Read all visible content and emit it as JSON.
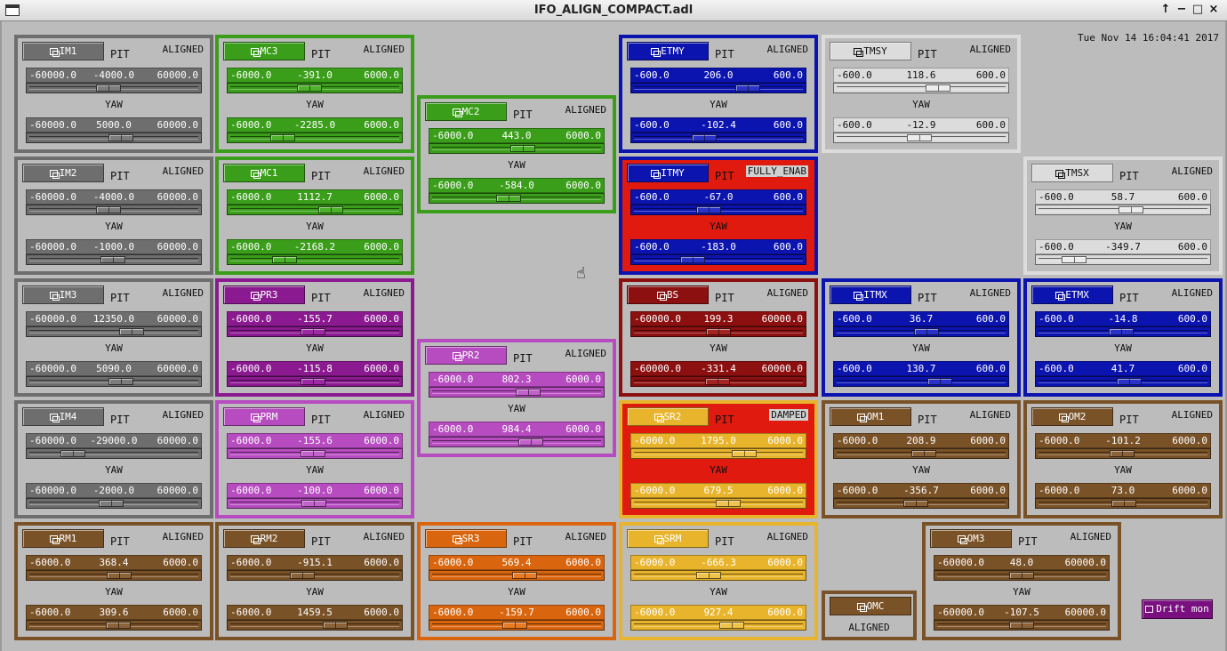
{
  "window": {
    "title": "IFO_ALIGN_COMPACT.adl"
  },
  "clock": "Tue Nov 14 16:04:41 2017",
  "drift_button": "Drift mon",
  "omc": {
    "label": "OMC",
    "status": "ALIGNED"
  },
  "colors": {
    "gray": "#6e6e6e",
    "green": "#3a9e1a",
    "purple": "#8b1a91",
    "violet": "#b64cc0",
    "blue": "#0c14b0",
    "brown": "#7a5228",
    "orange": "#d9660f",
    "yellow": "#e8b42c",
    "red": "#e01a0e",
    "darkred": "#8c1010",
    "white": "#dcdcdc"
  },
  "panels": [
    {
      "label": "IM1",
      "status": "ALIGNED",
      "theme": "gray",
      "pit": {
        "min": "-60000.0",
        "val": "-4000.0",
        "max": "60000.0",
        "frac": 0.467
      },
      "yaw": {
        "min": "-60000.0",
        "val": "5000.0",
        "max": "60000.0",
        "frac": 0.542
      }
    },
    {
      "label": "MC3",
      "status": "ALIGNED",
      "theme": "green",
      "pit": {
        "min": "-6000.0",
        "val": "-391.0",
        "max": "6000.0",
        "frac": 0.467
      },
      "yaw": {
        "min": "-6000.0",
        "val": "-2285.0",
        "max": "6000.0",
        "frac": 0.31
      }
    },
    {
      "label": "MC2",
      "status": "ALIGNED",
      "theme": "green",
      "pit": {
        "min": "-6000.0",
        "val": "443.0",
        "max": "6000.0",
        "frac": 0.537
      },
      "yaw": {
        "min": "-6000.0",
        "val": "-584.0",
        "max": "6000.0",
        "frac": 0.451
      }
    },
    {
      "label": "ETMY",
      "status": "ALIGNED",
      "theme": "blue",
      "pit": {
        "min": "-600.0",
        "val": "206.0",
        "max": "600.0",
        "frac": 0.672
      },
      "yaw": {
        "min": "-600.0",
        "val": "-102.4",
        "max": "600.0",
        "frac": 0.415
      }
    },
    {
      "label": "TMSY",
      "status": "ALIGNED",
      "theme": "white",
      "pit": {
        "min": "-600.0",
        "val": "118.6",
        "max": "600.0",
        "frac": 0.599
      },
      "yaw": {
        "min": "-600.0",
        "val": "-12.9",
        "max": "600.0",
        "frac": 0.489
      }
    },
    {
      "label": "IM2",
      "status": "ALIGNED",
      "theme": "gray",
      "pit": {
        "min": "-60000.0",
        "val": "-4000.0",
        "max": "60000.0",
        "frac": 0.467
      },
      "yaw": {
        "min": "-60000.0",
        "val": "-1000.0",
        "max": "60000.0",
        "frac": 0.492
      }
    },
    {
      "label": "MC1",
      "status": "ALIGNED",
      "theme": "green",
      "pit": {
        "min": "-6000.0",
        "val": "1112.7",
        "max": "6000.0",
        "frac": 0.593
      },
      "yaw": {
        "min": "-6000.0",
        "val": "-2168.2",
        "max": "6000.0",
        "frac": 0.319
      }
    },
    {
      "label": "ITMY",
      "status": "FULLY_ENAB",
      "theme": "blue",
      "alarm": "red",
      "pit": {
        "min": "-600.0",
        "val": "-67.0",
        "max": "600.0",
        "frac": 0.444
      },
      "yaw": {
        "min": "-600.0",
        "val": "-183.0",
        "max": "600.0",
        "frac": 0.348
      }
    },
    {
      "label": "TMSX",
      "status": "ALIGNED",
      "theme": "white",
      "pit": {
        "min": "-600.0",
        "val": "58.7",
        "max": "600.0",
        "frac": 0.549
      },
      "yaw": {
        "min": "-600.0",
        "val": "-349.7",
        "max": "600.0",
        "frac": 0.209
      }
    },
    {
      "label": "IM3",
      "status": "ALIGNED",
      "theme": "gray",
      "pit": {
        "min": "-60000.0",
        "val": "12350.0",
        "max": "60000.0",
        "frac": 0.603
      },
      "yaw": {
        "min": "-60000.0",
        "val": "5090.0",
        "max": "60000.0",
        "frac": 0.542
      }
    },
    {
      "label": "PR3",
      "status": "ALIGNED",
      "theme": "purple",
      "pit": {
        "min": "-6000.0",
        "val": "-155.7",
        "max": "6000.0",
        "frac": 0.487
      },
      "yaw": {
        "min": "-6000.0",
        "val": "-115.8",
        "max": "6000.0",
        "frac": 0.49
      }
    },
    {
      "label": "PR2",
      "status": "ALIGNED",
      "theme": "violet",
      "pit": {
        "min": "-6000.0",
        "val": "802.3",
        "max": "6000.0",
        "frac": 0.567
      },
      "yaw": {
        "min": "-6000.0",
        "val": "984.4",
        "max": "6000.0",
        "frac": 0.582
      }
    },
    {
      "label": "BS",
      "status": "ALIGNED",
      "theme": "darkred",
      "pit": {
        "min": "-60000.0",
        "val": "199.3",
        "max": "60000.0",
        "frac": 0.502
      },
      "yaw": {
        "min": "-60000.0",
        "val": "-331.4",
        "max": "60000.0",
        "frac": 0.497
      }
    },
    {
      "label": "ITMX",
      "status": "ALIGNED",
      "theme": "blue",
      "pit": {
        "min": "-600.0",
        "val": "36.7",
        "max": "600.0",
        "frac": 0.531
      },
      "yaw": {
        "min": "-600.0",
        "val": "130.7",
        "max": "600.0",
        "frac": 0.609
      }
    },
    {
      "label": "ETMX",
      "status": "ALIGNED",
      "theme": "blue",
      "pit": {
        "min": "-600.0",
        "val": "-14.8",
        "max": "600.0",
        "frac": 0.488
      },
      "yaw": {
        "min": "-600.0",
        "val": "41.7",
        "max": "600.0",
        "frac": 0.535
      }
    },
    {
      "label": "IM4",
      "status": "ALIGNED",
      "theme": "gray",
      "pit": {
        "min": "-60000.0",
        "val": "-29000.0",
        "max": "60000.0",
        "frac": 0.258
      },
      "yaw": {
        "min": "-60000.0",
        "val": "-2000.0",
        "max": "60000.0",
        "frac": 0.483
      }
    },
    {
      "label": "PRM",
      "status": "ALIGNED",
      "theme": "violet",
      "pit": {
        "min": "-6000.0",
        "val": "-155.6",
        "max": "6000.0",
        "frac": 0.487
      },
      "yaw": {
        "min": "-6000.0",
        "val": "-100.0",
        "max": "6000.0",
        "frac": 0.492
      }
    },
    {
      "label": "SR2",
      "status": "DAMPED",
      "theme": "yellow",
      "alarm": "red",
      "pit": {
        "min": "-6000.0",
        "val": "1795.0",
        "max": "6000.0",
        "frac": 0.65
      },
      "yaw": {
        "min": "-6000.0",
        "val": "679.5",
        "max": "6000.0",
        "frac": 0.557
      }
    },
    {
      "label": "OM1",
      "status": "ALIGNED",
      "theme": "brown",
      "pit": {
        "min": "-6000.0",
        "val": "208.9",
        "max": "6000.0",
        "frac": 0.517
      },
      "yaw": {
        "min": "-6000.0",
        "val": "-356.7",
        "max": "6000.0",
        "frac": 0.47
      }
    },
    {
      "label": "OM2",
      "status": "ALIGNED",
      "theme": "brown",
      "pit": {
        "min": "-6000.0",
        "val": "-101.2",
        "max": "6000.0",
        "frac": 0.492
      },
      "yaw": {
        "min": "-6000.0",
        "val": "73.0",
        "max": "6000.0",
        "frac": 0.506
      }
    },
    {
      "label": "RM1",
      "status": "ALIGNED",
      "theme": "brown",
      "pit": {
        "min": "-6000.0",
        "val": "368.4",
        "max": "6000.0",
        "frac": 0.531
      },
      "yaw": {
        "min": "-6000.0",
        "val": "309.6",
        "max": "6000.0",
        "frac": 0.526
      }
    },
    {
      "label": "RM2",
      "status": "ALIGNED",
      "theme": "brown",
      "pit": {
        "min": "-6000.0",
        "val": "-915.1",
        "max": "6000.0",
        "frac": 0.424
      },
      "yaw": {
        "min": "-6000.0",
        "val": "1459.5",
        "max": "6000.0",
        "frac": 0.622
      }
    },
    {
      "label": "SR3",
      "status": "ALIGNED",
      "theme": "orange",
      "pit": {
        "min": "-6000.0",
        "val": "569.4",
        "max": "6000.0",
        "frac": 0.547
      },
      "yaw": {
        "min": "-6000.0",
        "val": "-159.7",
        "max": "6000.0",
        "frac": 0.487
      }
    },
    {
      "label": "SRM",
      "status": "ALIGNED",
      "theme": "yellow",
      "pit": {
        "min": "-6000.0",
        "val": "-666.3",
        "max": "6000.0",
        "frac": 0.444
      },
      "yaw": {
        "min": "-6000.0",
        "val": "927.4",
        "max": "6000.0",
        "frac": 0.577
      }
    },
    {
      "label": "OM3",
      "status": "ALIGNED",
      "theme": "brown",
      "pit": {
        "min": "-60000.0",
        "val": "48.0",
        "max": "60000.0",
        "frac": 0.5
      },
      "yaw": {
        "min": "-60000.0",
        "val": "-107.5",
        "max": "60000.0",
        "frac": 0.499
      }
    }
  ]
}
